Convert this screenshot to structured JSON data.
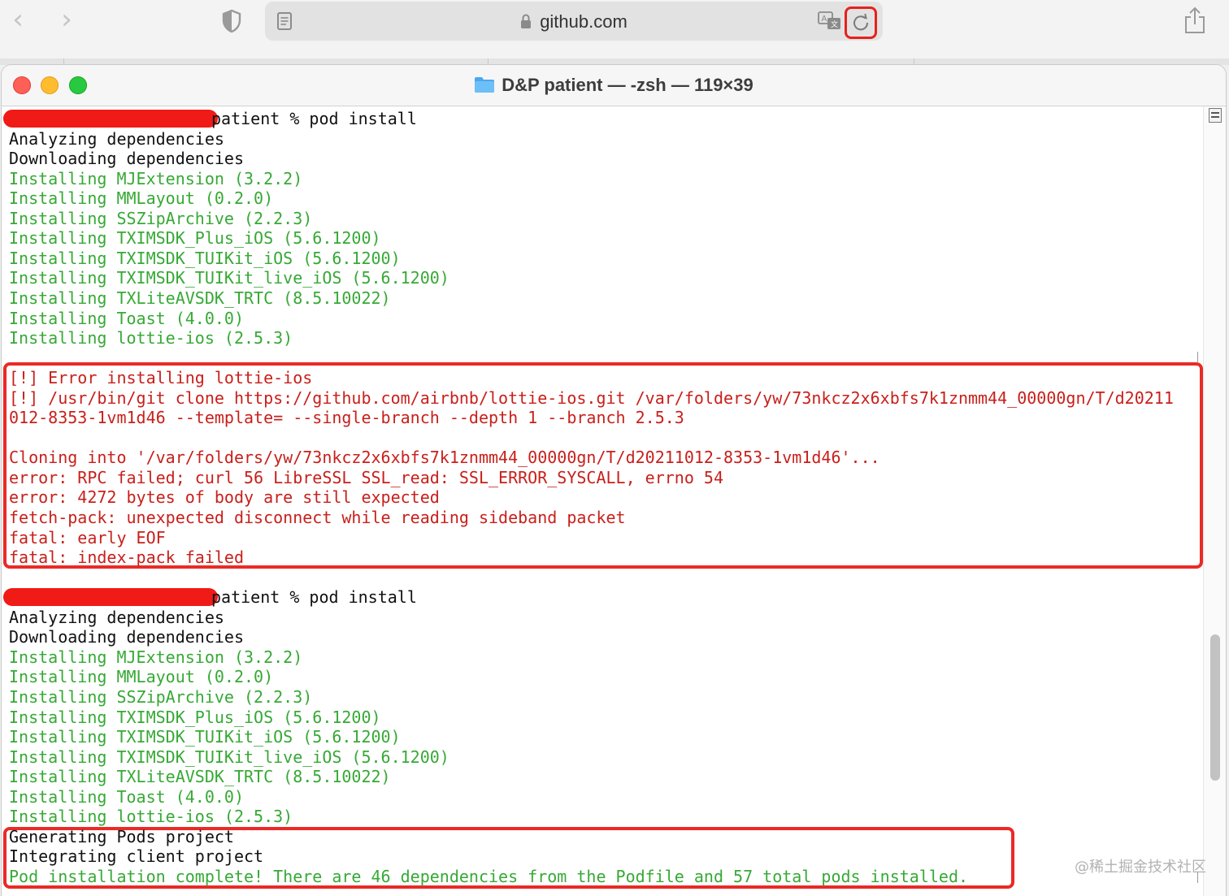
{
  "browser": {
    "back_icon": "chevron-left-icon",
    "forward_icon": "chevron-right-icon",
    "url": "github.com",
    "icons": [
      "shield-icon",
      "reader-icon",
      "lock-icon",
      "translate-icon",
      "reload-icon",
      "share-icon"
    ]
  },
  "terminal": {
    "title": "D&P patient — -zsh — 119×39",
    "lines": [
      {
        "text": "patient % pod install",
        "color": "default",
        "redacted_prefix": true
      },
      {
        "text": "Analyzing dependencies",
        "color": "default"
      },
      {
        "text": "Downloading dependencies",
        "color": "default"
      },
      {
        "text": "Installing MJExtension (3.2.2)",
        "color": "green"
      },
      {
        "text": "Installing MMLayout (0.2.0)",
        "color": "green"
      },
      {
        "text": "Installing SSZipArchive (2.2.3)",
        "color": "green"
      },
      {
        "text": "Installing TXIMSDK_Plus_iOS (5.6.1200)",
        "color": "green"
      },
      {
        "text": "Installing TXIMSDK_TUIKit_iOS (5.6.1200)",
        "color": "green"
      },
      {
        "text": "Installing TXIMSDK_TUIKit_live_iOS (5.6.1200)",
        "color": "green"
      },
      {
        "text": "Installing TXLiteAVSDK_TRTC (8.5.10022)",
        "color": "green"
      },
      {
        "text": "Installing Toast (4.0.0)",
        "color": "green"
      },
      {
        "text": "Installing lottie-ios (2.5.3)",
        "color": "green"
      },
      {
        "text": "",
        "color": "default"
      },
      {
        "text": "[!] Error installing lottie-ios",
        "color": "red"
      },
      {
        "text": "[!] /usr/bin/git clone https://github.com/airbnb/lottie-ios.git /var/folders/yw/73nkcz2x6xbfs7k1znmm44_00000gn/T/d20211",
        "color": "red"
      },
      {
        "text": "012-8353-1vm1d46 --template= --single-branch --depth 1 --branch 2.5.3",
        "color": "red"
      },
      {
        "text": "",
        "color": "default"
      },
      {
        "text": "Cloning into '/var/folders/yw/73nkcz2x6xbfs7k1znmm44_00000gn/T/d20211012-8353-1vm1d46'...",
        "color": "red"
      },
      {
        "text": "error: RPC failed; curl 56 LibreSSL SSL_read: SSL_ERROR_SYSCALL, errno 54",
        "color": "red"
      },
      {
        "text": "error: 4272 bytes of body are still expected",
        "color": "red"
      },
      {
        "text": "fetch-pack: unexpected disconnect while reading sideband packet",
        "color": "red"
      },
      {
        "text": "fatal: early EOF",
        "color": "red"
      },
      {
        "text": "fatal: index-pack failed",
        "color": "red"
      },
      {
        "text": "",
        "color": "default"
      },
      {
        "text": "patient % pod install",
        "color": "default",
        "redacted_prefix": true
      },
      {
        "text": "Analyzing dependencies",
        "color": "default"
      },
      {
        "text": "Downloading dependencies",
        "color": "default"
      },
      {
        "text": "Installing MJExtension (3.2.2)",
        "color": "green"
      },
      {
        "text": "Installing MMLayout (0.2.0)",
        "color": "green"
      },
      {
        "text": "Installing SSZipArchive (2.2.3)",
        "color": "green"
      },
      {
        "text": "Installing TXIMSDK_Plus_iOS (5.6.1200)",
        "color": "green"
      },
      {
        "text": "Installing TXIMSDK_TUIKit_iOS (5.6.1200)",
        "color": "green"
      },
      {
        "text": "Installing TXIMSDK_TUIKit_live_iOS (5.6.1200)",
        "color": "green"
      },
      {
        "text": "Installing TXLiteAVSDK_TRTC (8.5.10022)",
        "color": "green"
      },
      {
        "text": "Installing Toast (4.0.0)",
        "color": "green"
      },
      {
        "text": "Installing lottie-ios (2.5.3)",
        "color": "green"
      },
      {
        "text": "Generating Pods project",
        "color": "default"
      },
      {
        "text": "Integrating client project",
        "color": "default"
      },
      {
        "text": "Pod installation complete! There are 46 dependencies from the Podfile and 57 total pods installed.",
        "color": "green"
      }
    ]
  },
  "watermark": "@稀土掘金技术社区",
  "colors": {
    "green": "#36a935",
    "red": "#c8201b",
    "highlight": "#ea2a26",
    "redaction": "#f01a16"
  }
}
